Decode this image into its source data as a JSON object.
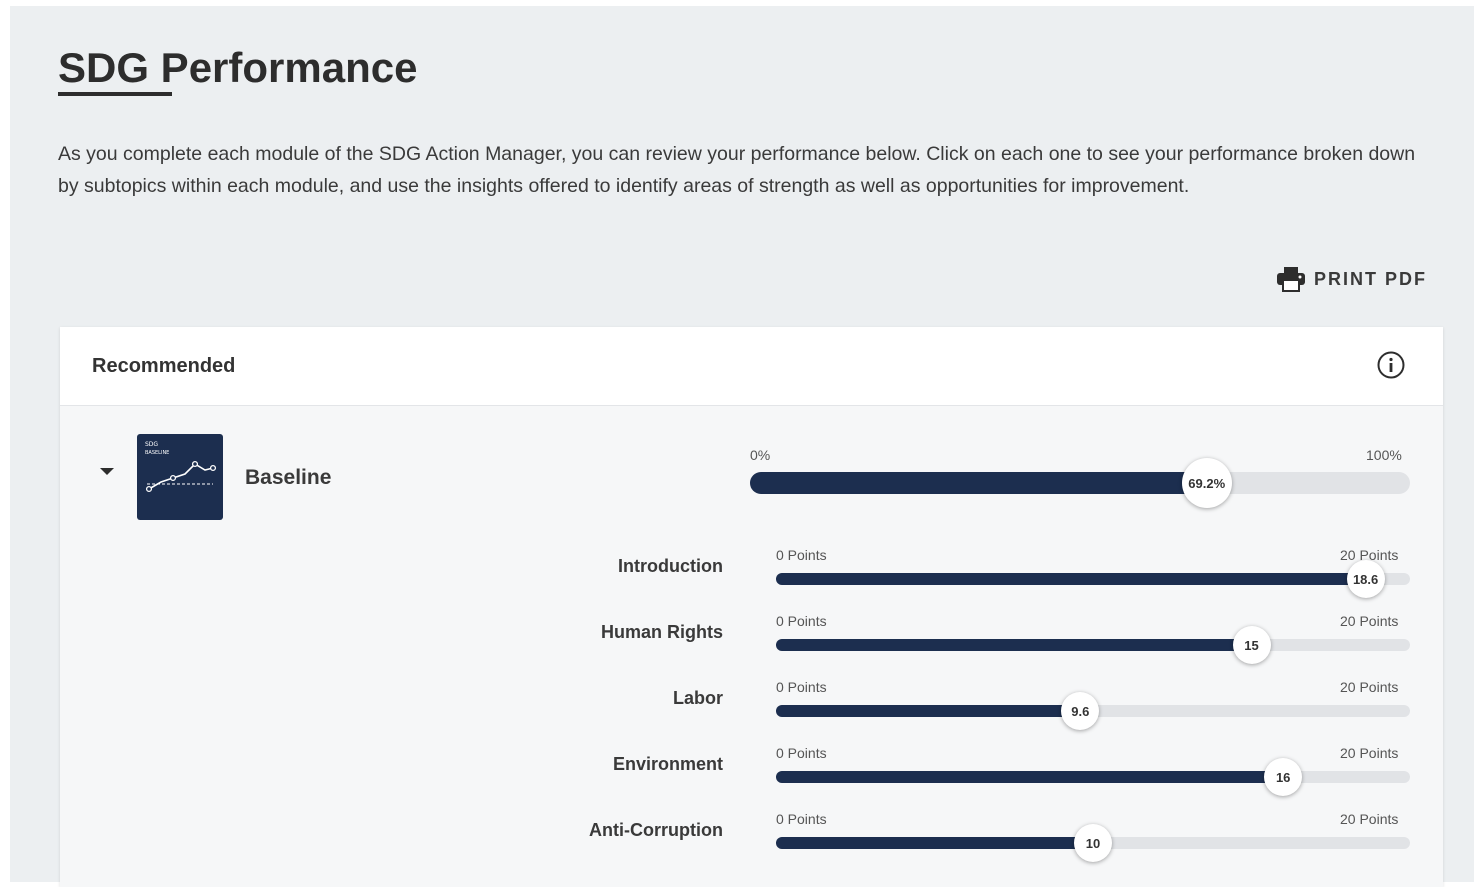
{
  "page": {
    "title": "SDG Performance",
    "intro": "As you complete each module of the SDG Action Manager, you can review your performance below. Click on each one to see your performance broken down by subtopics within each module, and use the insights offered to identify areas of strength as well as opportunities for improvement.",
    "print_label": "PRINT PDF"
  },
  "card": {
    "title": "Recommended",
    "module": {
      "name": "Baseline",
      "thumb_text": [
        "SDG",
        "BASELINE"
      ],
      "min_label": "0%",
      "max_label": "100%",
      "value": 69.2,
      "value_label": "69.2%"
    },
    "subtopics": [
      {
        "name": "Introduction",
        "value": 18.6,
        "value_label": "18.6",
        "min_label": "0 Points",
        "max_label": "20 Points"
      },
      {
        "name": "Human Rights",
        "value": 15,
        "value_label": "15",
        "min_label": "0 Points",
        "max_label": "20 Points"
      },
      {
        "name": "Labor",
        "value": 9.6,
        "value_label": "9.6",
        "min_label": "0 Points",
        "max_label": "20 Points"
      },
      {
        "name": "Environment",
        "value": 16,
        "value_label": "16",
        "min_label": "0 Points",
        "max_label": "20 Points"
      },
      {
        "name": "Anti-Corruption",
        "value": 10,
        "value_label": "10",
        "min_label": "0 Points",
        "max_label": "20 Points"
      }
    ],
    "subtopic_max": 20
  },
  "colors": {
    "accent": "#1c2e4f",
    "track": "#e1e3e6",
    "background": "#eceff1"
  },
  "icons": {
    "print": "printer-icon",
    "info": "info-icon",
    "expand": "caret-down-icon"
  }
}
